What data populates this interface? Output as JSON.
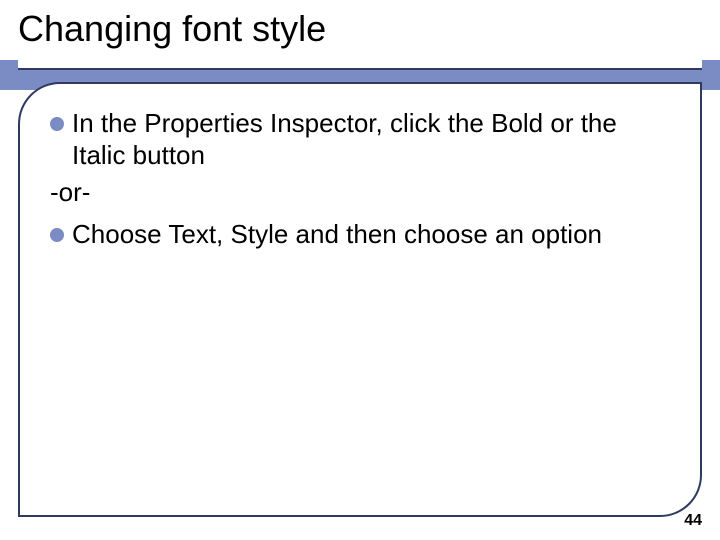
{
  "title": "Changing font style",
  "bullets": [
    "In the Properties Inspector, click the Bold or the Italic button",
    "Choose Text, Style and then choose an option"
  ],
  "separator": "-or-",
  "page_number": "44",
  "colors": {
    "accent": "#7b8cc4",
    "rule_dark": "#2e3a5e"
  }
}
